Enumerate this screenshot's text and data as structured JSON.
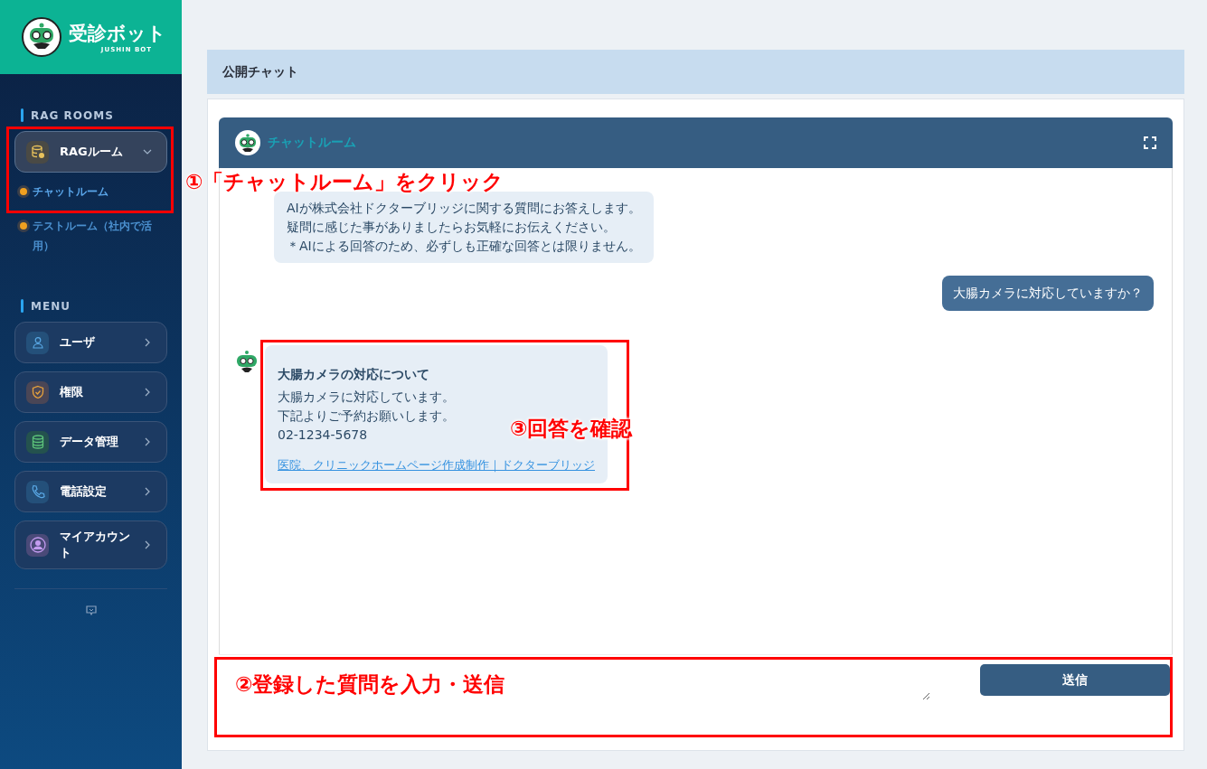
{
  "sidebar": {
    "logo": {
      "title": "受診ボット",
      "subtitle": "JUSHIN BOT"
    },
    "rag_rooms": {
      "heading": "RAG ROOMS",
      "group": {
        "label": "RAGルーム",
        "expanded": true,
        "rooms": [
          {
            "label": "チャットルーム",
            "selected": true
          },
          {
            "label": "テストルーム（社内で活用）",
            "selected": false
          }
        ]
      }
    },
    "menu": {
      "heading": "MENU",
      "items": [
        {
          "label": "ユーザ",
          "kind": "user"
        },
        {
          "label": "権限",
          "kind": "shield"
        },
        {
          "label": "データ管理",
          "kind": "database"
        },
        {
          "label": "電話設定",
          "kind": "phone"
        },
        {
          "label": "マイアカウント",
          "kind": "account"
        }
      ]
    }
  },
  "page_header": "公開チャット",
  "chat": {
    "title": "チャットルーム",
    "messages": [
      {
        "kind": "greeting",
        "lines": [
          "AIが株式会社ドクターブリッジに関する質問にお答えします。",
          "疑問に感じた事がありましたらお気軽にお伝えください。",
          "＊AIによる回答のため、必ずしも正確な回答とは限りません。"
        ]
      },
      {
        "kind": "question",
        "lines": [
          "大腸カメラに対応していますか？"
        ]
      },
      {
        "kind": "answer",
        "title": "大腸カメラの対応について",
        "lines": [
          "大腸カメラに対応しています。",
          "下記よりご予約お願いします。",
          "02-1234-5678"
        ],
        "link": "医院、クリニックホームページ作成制作｜ドクターブリッジ"
      }
    ],
    "send_button": "送信"
  },
  "annotations": [
    {
      "label": "①「チャットルーム」をクリック"
    },
    {
      "label": "②登録した質問を入力・送信"
    },
    {
      "label": "③回答を確認"
    }
  ]
}
